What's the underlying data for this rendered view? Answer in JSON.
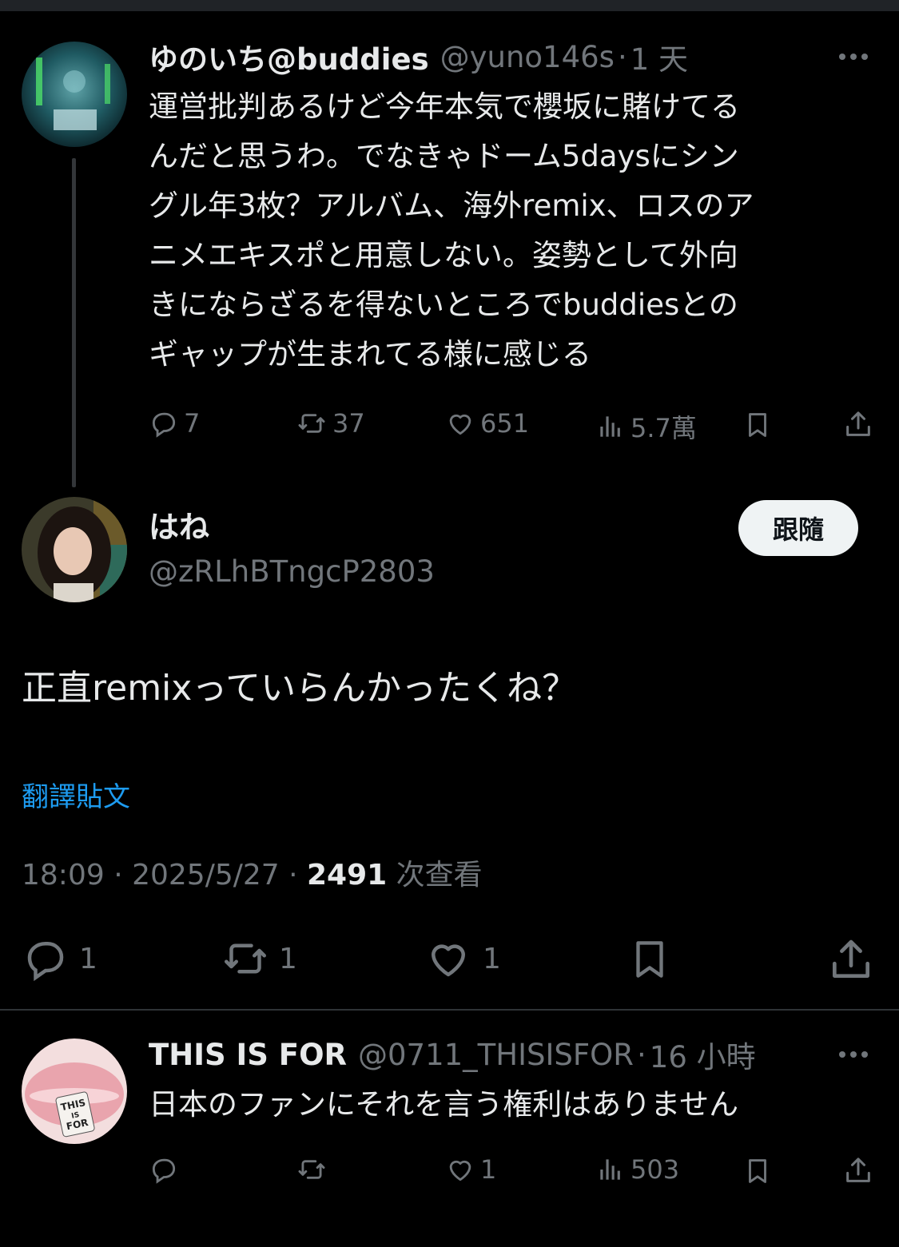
{
  "tweet1": {
    "display_name": "ゆのいち@buddies",
    "handle": "@yuno146s",
    "separator": "·",
    "time": "1 天",
    "text_lines": [
      "運営批判あるけど今年本気で櫻坂に賭けてる",
      "んだと思うわ。でなきゃドーム5daysにシン",
      "グル年3枚？アルバム、海外remix、ロスのア",
      "ニメエキスポと用意しない。姿勢として外向",
      "きにならざるを得ないところでbuddiesとの",
      "ギャップが生まれてる様に感じる"
    ],
    "replies": "7",
    "reposts": "37",
    "likes": "651",
    "views": "5.7萬"
  },
  "main_tweet": {
    "display_name": "はね",
    "handle": "@zRLhBTngcP2803",
    "follow_label": "跟隨",
    "text": "正直remixっていらんかったくね？",
    "translate_label": "翻譯貼文",
    "timestamp": "18:09 · 2025/5/27 · ",
    "views_count": "2491",
    "views_label": " 次查看",
    "replies": "1",
    "reposts": "1",
    "likes": "1"
  },
  "reply1": {
    "display_name": "THIS IS FOR",
    "handle": "@0711_THISISFOR",
    "separator": "·",
    "time": "16 小時",
    "text": "日本のファンにそれを言う権利はありません",
    "avatar_text": [
      "THIS",
      "IS",
      "FOR"
    ],
    "likes": "1",
    "views": "503"
  },
  "colors": {
    "background": "#000000",
    "text": "#e7e9ea",
    "muted": "#71767b",
    "link": "#1d9bf0",
    "divider": "#2f3336"
  },
  "icons": [
    "reply-icon",
    "repost-icon",
    "like-icon",
    "views-icon",
    "bookmark-icon",
    "share-icon",
    "more-icon"
  ]
}
